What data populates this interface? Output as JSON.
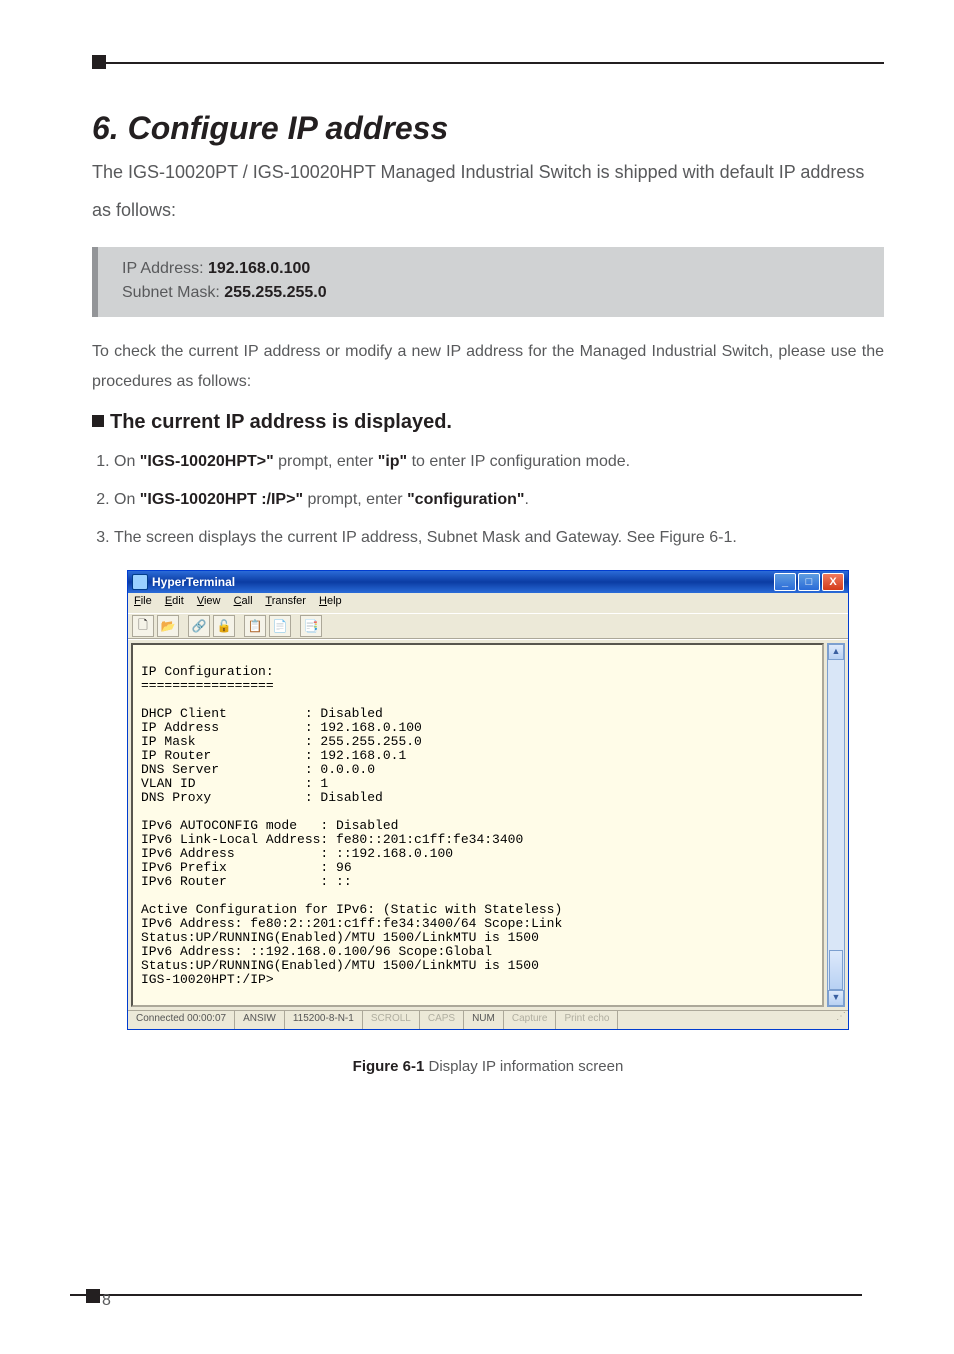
{
  "section": {
    "title": "6. Configure IP address",
    "intro": "The IGS-10020PT / IGS-10020HPT Managed Industrial Switch is shipped with default IP address as follows:"
  },
  "defaults": {
    "ip_label": "IP Address: ",
    "ip_value": "192.168.0.100",
    "mask_label": "Subnet Mask: ",
    "mask_value": "255.255.255.0"
  },
  "paragraph2": "To check the current IP address or modify a new IP address for the Managed Industrial Switch, please use the procedures as follows:",
  "subhead": "The current IP address is displayed.",
  "steps": {
    "s1_a": "On ",
    "s1_b": "\"IGS-10020HPT>\"",
    "s1_c": " prompt, enter ",
    "s1_d": "\"ip\"",
    "s1_e": " to enter IP configuration mode.",
    "s2_a": "On ",
    "s2_b": "\"IGS-10020HPT :/IP>\"",
    "s2_c": " prompt, enter ",
    "s2_d": "\"configuration\"",
    "s2_e": ".",
    "s3": "The screen displays the current IP address, Subnet Mask and Gateway. See Figure 6-1."
  },
  "hyperterminal": {
    "title": "HyperTerminal",
    "menu": {
      "file": "File",
      "edit": "Edit",
      "view": "View",
      "call": "Call",
      "transfer": "Transfer",
      "help": "Help"
    },
    "window_controls": {
      "min": "_",
      "max": "□",
      "close": "X"
    },
    "toolbar_icons": {
      "new": "🗋",
      "open": "📂",
      "connect": "🔗",
      "disconnect": "🔓",
      "send": "📋",
      "receive": "📄",
      "properties": "📑"
    },
    "terminal_text": "\nIP Configuration:\n=================\n\nDHCP Client          : Disabled\nIP Address           : 192.168.0.100\nIP Mask              : 255.255.255.0\nIP Router            : 192.168.0.1\nDNS Server           : 0.0.0.0\nVLAN ID              : 1\nDNS Proxy            : Disabled\n\nIPv6 AUTOCONFIG mode   : Disabled\nIPv6 Link-Local Address: fe80::201:c1ff:fe34:3400\nIPv6 Address           : ::192.168.0.100\nIPv6 Prefix            : 96\nIPv6 Router            : ::\n\nActive Configuration for IPv6: (Static with Stateless)\nIPv6 Address: fe80:2::201:c1ff:fe34:3400/64 Scope:Link\nStatus:UP/RUNNING(Enabled)/MTU 1500/LinkMTU is 1500\nIPv6 Address: ::192.168.0.100/96 Scope:Global\nStatus:UP/RUNNING(Enabled)/MTU 1500/LinkMTU is 1500\nIGS-10020HPT:/IP>",
    "status": {
      "connected": "Connected 00:00:07",
      "term": "ANSIW",
      "port": "115200-8-N-1",
      "scroll": "SCROLL",
      "caps": "CAPS",
      "num": "NUM",
      "capture": "Capture",
      "printecho": "Print echo"
    },
    "scroll_glyphs": {
      "up": "▲",
      "down": "▼"
    }
  },
  "figure": {
    "label": "Figure 6-1",
    "caption": "  Display IP information screen"
  },
  "page_number": "8"
}
